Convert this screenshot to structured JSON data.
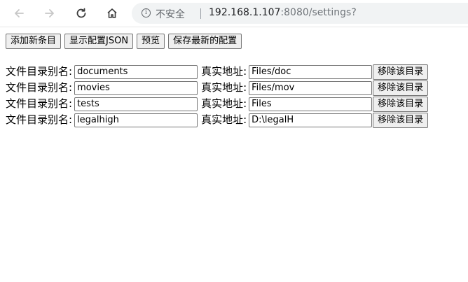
{
  "browser": {
    "security_label": "不安全",
    "url_host": "192.168.1.107",
    "url_rest": ":8080/settings?"
  },
  "toolbar": {
    "add_label": "添加新条目",
    "show_json_label": "显示配置JSON",
    "preview_label": "预览",
    "save_label": "保存最新的配置"
  },
  "rows": [
    {
      "alias_label": "文件目录别名:",
      "alias": "documents",
      "path_label": "真实地址:",
      "path": "Files/doc",
      "remove_label": "移除该目录"
    },
    {
      "alias_label": "文件目录别名:",
      "alias": "movies",
      "path_label": "真实地址:",
      "path": "Files/mov",
      "remove_label": "移除该目录"
    },
    {
      "alias_label": "文件目录别名:",
      "alias": "tests",
      "path_label": "真实地址:",
      "path": "Files",
      "remove_label": "移除该目录"
    },
    {
      "alias_label": "文件目录别名:",
      "alias": "legalhigh",
      "path_label": "真实地址:",
      "path": "D:\\legalH",
      "remove_label": "移除该目录"
    }
  ]
}
